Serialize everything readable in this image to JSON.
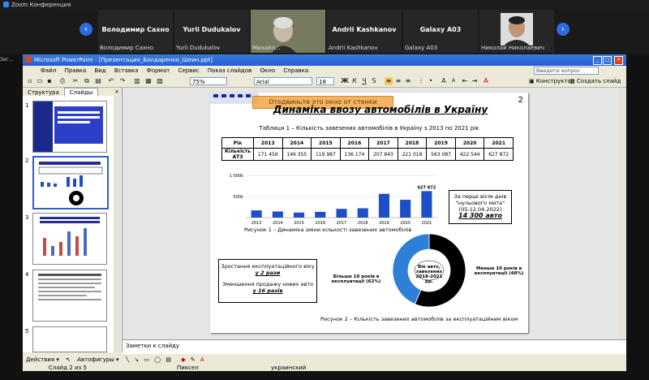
{
  "zoom": {
    "title": "Zoom Конференция",
    "tiles": [
      {
        "name": "Володимир  Сахно",
        "sub": "Володимир Сахно"
      },
      {
        "name": "Yurii Dudukalov",
        "sub": "Yurii Dudukalov"
      },
      {
        "name": "",
        "sub": "Михайл..."
      },
      {
        "name": "Andrii Kashkanov",
        "sub": "Andrii Kashkanov"
      },
      {
        "name": "Galaxy A03",
        "sub": "Galaxy A03"
      },
      {
        "name": "",
        "sub": "Николай  Николаевич"
      }
    ],
    "side_label": "Заг..."
  },
  "ppt": {
    "title": "Microsoft PowerPoint - [Презентация_Бондаренко_Шеин.ppt]",
    "menu": [
      "Файл",
      "Правка",
      "Вид",
      "Вставка",
      "Формат",
      "Сервис",
      "Показ слайдов",
      "Окно",
      "Справка"
    ],
    "help_placeholder": "Введите вопрос",
    "zoom_value": "75%",
    "font_name": "Arial",
    "font_size": "18",
    "designer_label": "Конструктор",
    "new_slide_label": "Создать слайд",
    "tabs": {
      "structure": "Структура",
      "slides": "Слайды"
    },
    "thumb_numbers": [
      "1",
      "2",
      "3",
      "4",
      "5"
    ],
    "notes_placeholder": "Заметки к слайду",
    "draw_actions": "Действия ▾",
    "autoshapes": "Автофигуры ▾",
    "status": {
      "slide": "Слайд 2 из 5",
      "design": "Пиксел",
      "lang": "украинский"
    }
  },
  "slide": {
    "number": "2",
    "banner": "Отодвиньте это окно от стенки",
    "title": "Динаміка ввозу автомобілів в Україну",
    "table_caption": "Таблиця 1 – Кількість завезених автомобілів в Україну з 2013 по 2021 рік",
    "table": {
      "header": [
        "Рік",
        "2013",
        "2014",
        "2015",
        "2016",
        "2017",
        "2018",
        "2019",
        "2020",
        "2021"
      ],
      "row_label": "Кількість АТЗ",
      "values": [
        "171 456",
        "146 355",
        "119 987",
        "136 174",
        "207 843",
        "221 018",
        "563 087",
        "422 544",
        "627 872"
      ]
    },
    "fig1_caption": "Рисунок 1 – Динаміка зміни кількості завезених автомобілів",
    "info_box": {
      "line1": "За перші вісім днів",
      "line2": "\"нульового мита\"",
      "line3": "(05-12.04.2022)",
      "highlight": "14 300 авто"
    },
    "box2": {
      "line1": "Зростання експлуатаційного віку",
      "hl1": "у 2 рази",
      "line2": "Зменшення продажу нових авто",
      "hl2": "у 16 разів"
    },
    "donut_center": "Вік авто, завезених 2018-2021 рр.",
    "donut_left": "Більше 10 років в експлуатації (62%)",
    "donut_right": "Менше 10 років в експлуатації (48%)",
    "fig2_caption": "Рисунок 2 – Кількість завезених автомобілів за експлуатаційним віком"
  },
  "chart_data": [
    {
      "type": "bar",
      "categories": [
        "2013",
        "2014",
        "2015",
        "2016",
        "2017",
        "2018",
        "2019",
        "2020",
        "2021"
      ],
      "values": [
        171456,
        146355,
        119987,
        136174,
        207843,
        221018,
        563087,
        422544,
        627872
      ],
      "data_labels": {
        "2021": "627 872"
      },
      "yticks": [
        "1 000k",
        "500k"
      ],
      "ylim": [
        0,
        1000000
      ],
      "color": "#1f4fc8"
    },
    {
      "type": "pie",
      "categories": [
        "Більше 10 років в експлуатації",
        "Менше 10 років в експлуатації"
      ],
      "values": [
        62,
        48
      ],
      "colors": [
        "#000000",
        "#2e7fd8"
      ]
    }
  ]
}
